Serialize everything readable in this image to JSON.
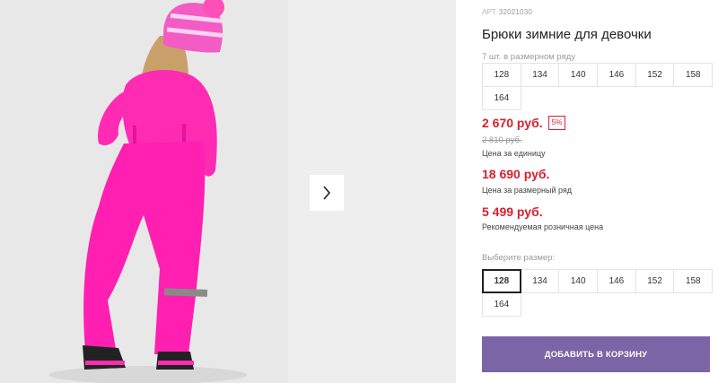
{
  "product": {
    "art_label": "АРТ",
    "art_number": "32021030",
    "title": "Брюки зимние для девочки",
    "row_note": "7 шт. в размерном ряду"
  },
  "size_row": [
    "128",
    "134",
    "140",
    "146",
    "152",
    "158",
    "164"
  ],
  "prices": {
    "unit_price": "2 670 руб.",
    "discount": "5%",
    "old_price": "2 810 руб.",
    "unit_caption": "Цена за единицу",
    "row_price": "18 690 руб.",
    "row_caption": "Цена за размерный ряд",
    "retail_price": "5 499 руб.",
    "retail_caption": "Рекомендуемая розничная цена"
  },
  "size_select": {
    "label": "Выберите размер:",
    "options": [
      "128",
      "134",
      "140",
      "146",
      "152",
      "158",
      "164"
    ],
    "selected": "128"
  },
  "add_to_cart_label": "ДОБАВИТЬ В КОРЗИНУ",
  "icons": {
    "next": "chevron-right-icon"
  },
  "colors": {
    "accent_button": "#7b65a6",
    "price_red": "#d8202e",
    "garment_pink": "#ff1fb0"
  }
}
